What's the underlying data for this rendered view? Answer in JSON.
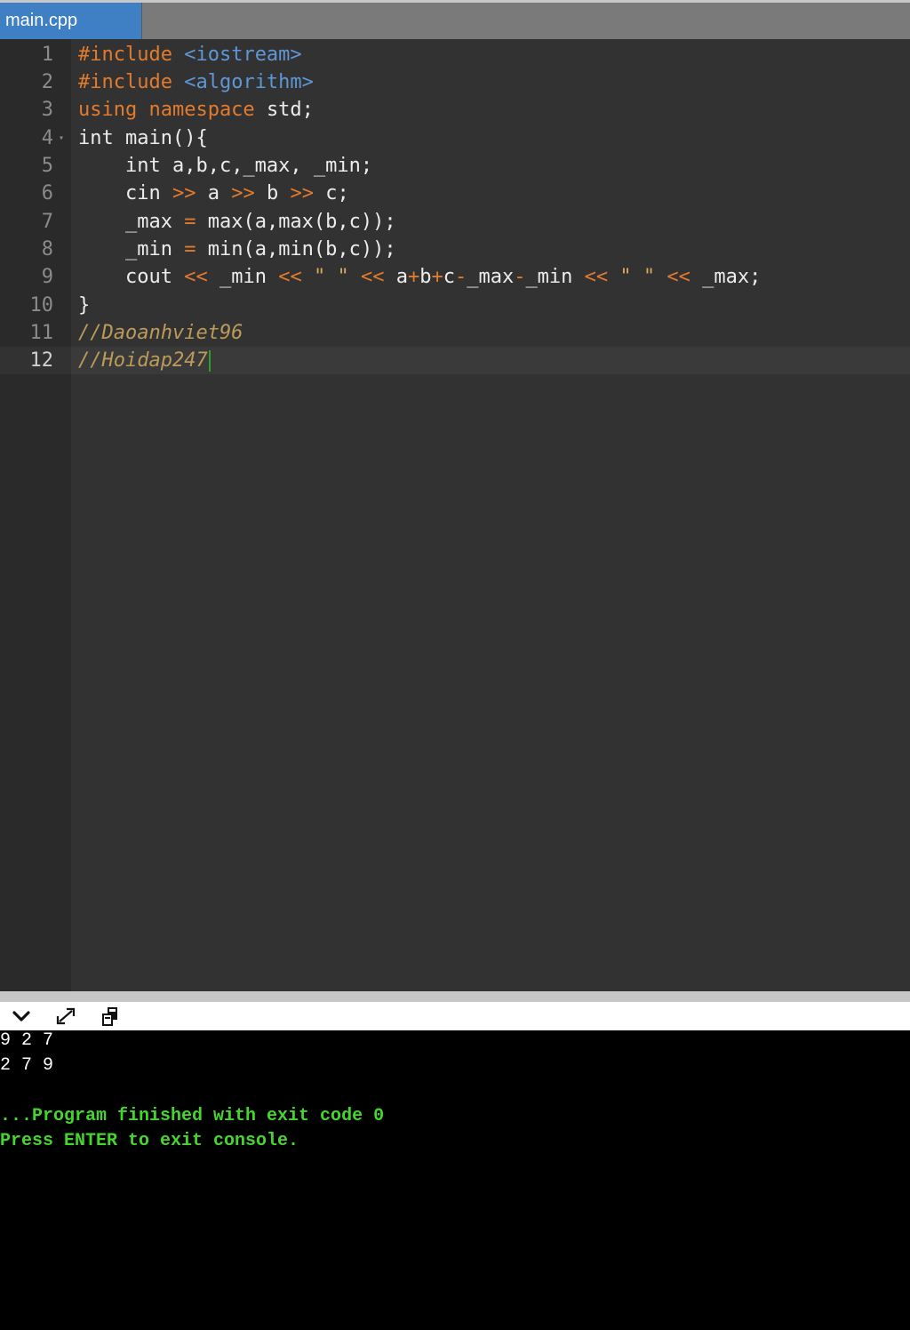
{
  "tab": {
    "label": "main.cpp"
  },
  "gutter": {
    "lines": [
      "1",
      "2",
      "3",
      "4",
      "5",
      "6",
      "7",
      "8",
      "9",
      "10",
      "11",
      "12"
    ],
    "fold_marker": "▾"
  },
  "code": {
    "line1": {
      "kw": "#include",
      "inc": "<iostream>"
    },
    "line2": {
      "kw": "#include",
      "inc": "<algorithm>"
    },
    "line3": {
      "kw": "using namespace",
      "rest": "std;"
    },
    "line4": {
      "text": "int main(){"
    },
    "line5": {
      "text": "int a,b,c,_max, _min;"
    },
    "line6": {
      "p1": "cin",
      "op1": ">>",
      "p2": "a",
      "op2": ">>",
      "p3": "b",
      "op3": ">>",
      "p4": "c;"
    },
    "line7": {
      "p1": "_max",
      "op1": "=",
      "p2": "max(a,max(b,c));"
    },
    "line8": {
      "p1": "_min",
      "op1": "=",
      "p2": "min(a,min(b,c));"
    },
    "line9": {
      "p1": "cout",
      "op1": "<<",
      "p2": "_min",
      "op2": "<<",
      "s1": "\" \"",
      "op3": "<<",
      "p3": "a",
      "op4": "+",
      "p4": "b",
      "op5": "+",
      "p5": "c",
      "op6": "-",
      "p6": "_max",
      "op7": "-",
      "p7": "_min",
      "op8": "<<",
      "s2": "\" \"",
      "op9": "<<",
      "p8": "_max;"
    },
    "line10": {
      "text": "}"
    },
    "line11": {
      "comment": "//Daoanhviet96"
    },
    "line12": {
      "comment": "//Hoidap247"
    }
  },
  "console": {
    "output": [
      "9 2 7",
      "2 7 9"
    ],
    "status": "...Program finished with exit code 0",
    "prompt": "Press ENTER to exit console."
  },
  "colors": {
    "keyword": "#e37b2e",
    "include": "#5e97d6",
    "comment": "#bc9a5a",
    "console_status": "#44d62c",
    "tab_active": "#3f7fc4"
  },
  "icons": [
    "chevron-down-icon",
    "expand-icon",
    "copy-icon"
  ]
}
